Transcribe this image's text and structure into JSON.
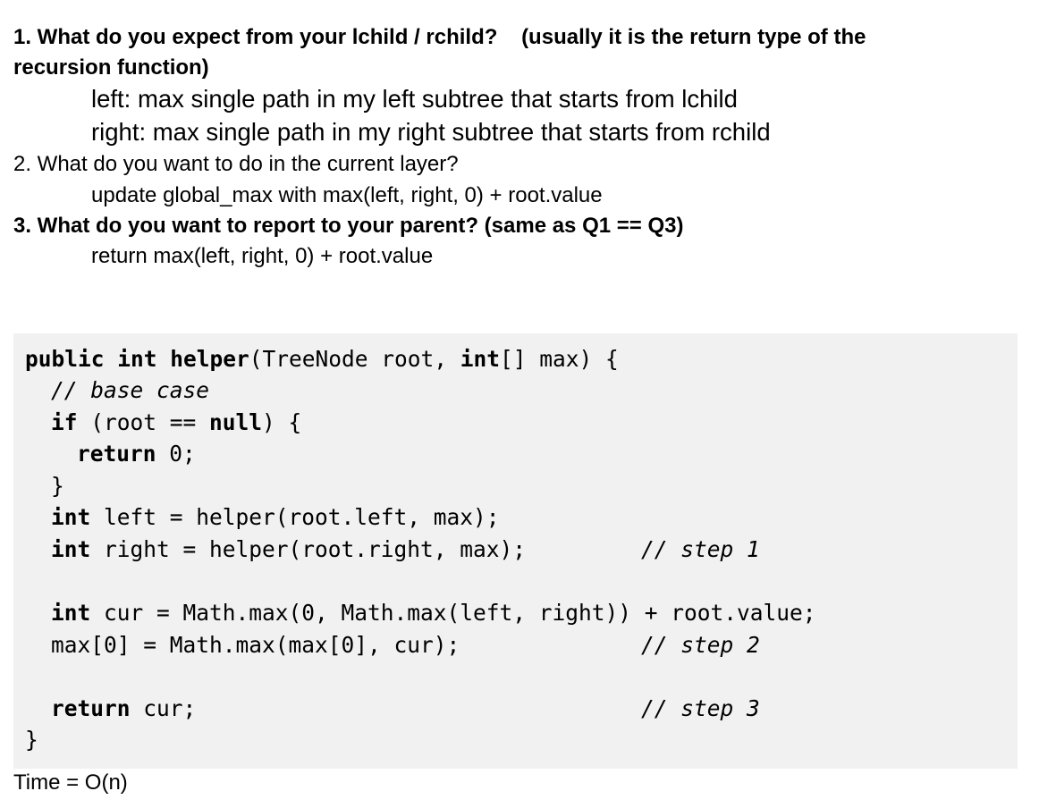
{
  "questions": [
    {
      "line1": "1. What do you expect from your lchild / rchild?    (usually it is the return type of the",
      "line2": "recursion function)",
      "answers": [
        "left: max single path in my left subtree that starts from lchild",
        "right: max single path in my right subtree that starts from rchild"
      ]
    },
    {
      "line1": "2. What do you want to do in the current layer?",
      "answers": [
        "update global_max with max(left, right, 0) + root.value"
      ]
    },
    {
      "line1": "3. What do you want to report to your parent? (same as Q1 == Q3)",
      "answers": [
        "return max(left, right, 0) + root.value"
      ]
    }
  ],
  "code": {
    "l1": {
      "kw1": "public int helper",
      "t1": "(TreeNode root, ",
      "kw2": "int",
      "t2": "[] max) {"
    },
    "l2": {
      "c": "// base case"
    },
    "l3": {
      "kw1": "if",
      "t1": " (root == ",
      "kw2": "null",
      "t2": ") {"
    },
    "l4": {
      "kw1": "return",
      "t1": " 0;"
    },
    "l5": {
      "t1": "}"
    },
    "l6": {
      "kw1": "int",
      "t1": " left = helper(root.left, max);"
    },
    "l7": {
      "kw1": "int",
      "t1": " right = helper(root.right, max);",
      "c": "// step 1"
    },
    "l8": {
      "kw1": "int",
      "t1": " cur = Math.max(0, Math.max(left, right)) + root.value;"
    },
    "l9": {
      "t1": "max[0] = Math.max(max[0], cur);",
      "c": "// step 2"
    },
    "l10": {
      "kw1": "return",
      "t1": " cur;",
      "c": "// step 3"
    },
    "l11": {
      "t1": "}"
    }
  },
  "footer": {
    "time": "Time = O(n)"
  }
}
